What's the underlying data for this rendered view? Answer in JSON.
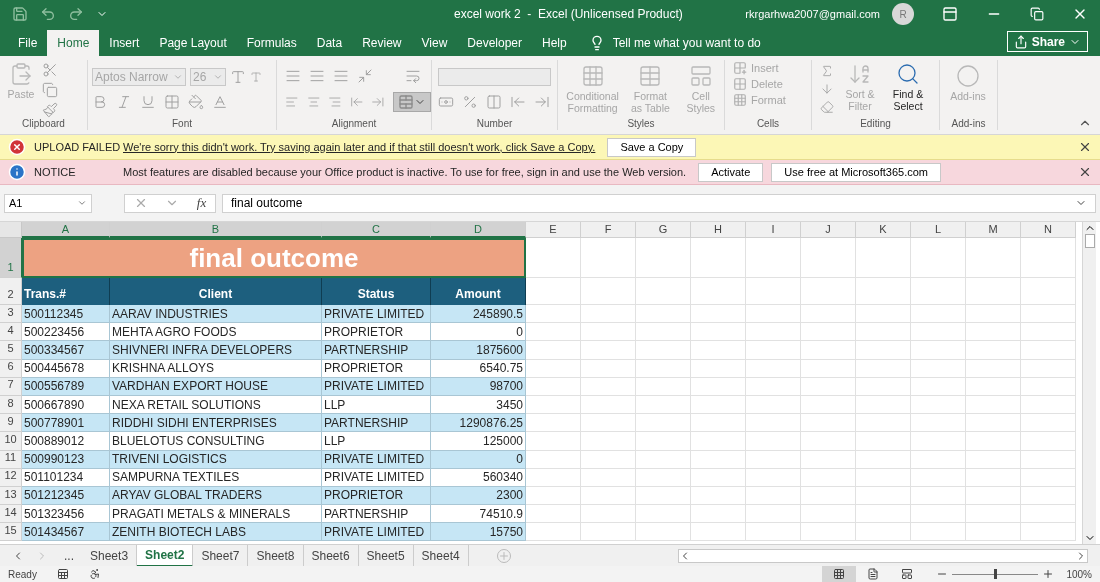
{
  "title_bar": {
    "title": "excel work 2  -  Excel (Unlicensed Product)",
    "account": "rkrgarhwa2007@gmail.com",
    "avatar": "R"
  },
  "menu_tabs": [
    {
      "label": "File",
      "selected": false
    },
    {
      "label": "Home",
      "selected": true
    },
    {
      "label": "Insert",
      "selected": false
    },
    {
      "label": "Page Layout",
      "selected": false
    },
    {
      "label": "Formulas",
      "selected": false
    },
    {
      "label": "Data",
      "selected": false
    },
    {
      "label": "Review",
      "selected": false
    },
    {
      "label": "View",
      "selected": false
    },
    {
      "label": "Developer",
      "selected": false
    },
    {
      "label": "Help",
      "selected": false
    }
  ],
  "tell_me": "Tell me what you want to do",
  "share": "Share",
  "ribbon": {
    "groups": [
      {
        "label": "Clipboard",
        "items": [
          {
            "kind": "large",
            "label": "Paste",
            "disabled": true
          }
        ]
      },
      {
        "label": "Font",
        "items": [
          {
            "kind": "field",
            "value": "Aptos Narrow",
            "disabled": true
          },
          {
            "kind": "field",
            "value": "26",
            "disabled": true
          }
        ]
      },
      {
        "label": "Alignment"
      },
      {
        "label": "Number"
      },
      {
        "label": "Styles",
        "items": [
          {
            "kind": "large",
            "label": "Conditional Formatting",
            "disabled": true
          },
          {
            "kind": "large",
            "label": "Format as Table",
            "disabled": true
          },
          {
            "kind": "large",
            "label": "Cell Styles",
            "disabled": true
          }
        ]
      },
      {
        "label": "Cells",
        "items": [
          {
            "kind": "small",
            "label": "Insert",
            "disabled": true
          },
          {
            "kind": "small",
            "label": "Delete",
            "disabled": true
          },
          {
            "kind": "small",
            "label": "Format",
            "disabled": true
          }
        ]
      },
      {
        "label": "Editing",
        "items": [
          {
            "kind": "large",
            "label": "Sort & Filter",
            "disabled": true
          },
          {
            "kind": "large",
            "label": "Find & Select",
            "disabled": false
          }
        ]
      },
      {
        "label": "Add-ins",
        "items": [
          {
            "kind": "large",
            "label": "Add-ins",
            "disabled": true
          }
        ]
      }
    ]
  },
  "message_bars": [
    {
      "kind": "error",
      "title": "UPLOAD FAILED",
      "message": "We're sorry this didn't work. Try saving again later and if that still doesn't work, click Save a Copy.",
      "buttons": [
        "Save a Copy"
      ]
    },
    {
      "kind": "info",
      "title": "NOTICE",
      "message": "Most features are disabled because your Office product is inactive. To use for free, sign in and use the Web version.",
      "buttons": [
        "Activate",
        "Use free at Microsoft365.com"
      ]
    }
  ],
  "formula_bar": {
    "name_box": "A1",
    "fx": "fx",
    "formula": "final outcome"
  },
  "sheet": {
    "columns": [
      {
        "label": "A",
        "selected": true
      },
      {
        "label": "B",
        "selected": true
      },
      {
        "label": "C",
        "selected": true
      },
      {
        "label": "D",
        "selected": true
      },
      {
        "label": "E",
        "selected": false
      },
      {
        "label": "F",
        "selected": false
      },
      {
        "label": "G",
        "selected": false
      },
      {
        "label": "H",
        "selected": false
      },
      {
        "label": "I",
        "selected": false
      },
      {
        "label": "J",
        "selected": false
      },
      {
        "label": "K",
        "selected": false
      },
      {
        "label": "L",
        "selected": false
      },
      {
        "label": "M",
        "selected": false
      },
      {
        "label": "N",
        "selected": false
      }
    ],
    "title_row": {
      "number": "1",
      "selected": true,
      "text": "final outcome"
    },
    "header_row": {
      "number": "2",
      "selected": false,
      "cells": [
        "Trans.#",
        "Client",
        "Status",
        "Amount"
      ]
    },
    "rows": [
      {
        "number": "3",
        "selected": false,
        "cells": [
          "500112345",
          "AARAV INDUSTRIES",
          "PRIVATE LIMITED",
          "245890.5"
        ]
      },
      {
        "number": "4",
        "selected": false,
        "cells": [
          "500223456",
          "MEHTA AGRO FOODS",
          "PROPRIETOR",
          "0"
        ]
      },
      {
        "number": "5",
        "selected": false,
        "cells": [
          "500334567",
          "SHIVNERI INFRA DEVELOPERS",
          "PARTNERSHIP",
          "1875600"
        ]
      },
      {
        "number": "6",
        "selected": false,
        "cells": [
          "500445678",
          "KRISHNA ALLOYS",
          "PROPRIETOR",
          "6540.75"
        ]
      },
      {
        "number": "7",
        "selected": false,
        "cells": [
          "500556789",
          "VARDHAN EXPORT HOUSE",
          "PRIVATE LIMITED",
          "98700"
        ]
      },
      {
        "number": "8",
        "selected": false,
        "cells": [
          "500667890",
          "NEXA RETAIL SOLUTIONS",
          "LLP",
          "3450"
        ]
      },
      {
        "number": "9",
        "selected": false,
        "cells": [
          "500778901",
          "RIDDHI SIDHI ENTERPRISES",
          "PARTNERSHIP",
          "1290876.25"
        ]
      },
      {
        "number": "10",
        "selected": false,
        "cells": [
          "500889012",
          "BLUELOTUS CONSULTING",
          "LLP",
          "125000"
        ]
      },
      {
        "number": "11",
        "selected": false,
        "cells": [
          "500990123",
          "TRIVENI LOGISTICS",
          "PRIVATE LIMITED",
          "0"
        ]
      },
      {
        "number": "12",
        "selected": false,
        "cells": [
          "501101234",
          "SAMPURNA TEXTILES",
          "PRIVATE LIMITED",
          "560340"
        ]
      },
      {
        "number": "13",
        "selected": false,
        "cells": [
          "501212345",
          "ARYAV GLOBAL TRADERS",
          "PROPRIETOR",
          "2300"
        ]
      },
      {
        "number": "14",
        "selected": false,
        "cells": [
          "501323456",
          "PRAGATI METALS & MINERALS",
          "PARTNERSHIP",
          "74510.9"
        ]
      },
      {
        "number": "15",
        "selected": false,
        "cells": [
          "501434567",
          "ZENITH BIOTECH LABS",
          "PRIVATE LIMITED",
          "15750"
        ]
      }
    ]
  },
  "sheet_tabs": {
    "more": "...",
    "tabs": [
      {
        "label": "Sheet3",
        "selected": false
      },
      {
        "label": "Sheet2",
        "selected": true
      },
      {
        "label": "Sheet7",
        "selected": false
      },
      {
        "label": "Sheet8",
        "selected": false
      },
      {
        "label": "Sheet6",
        "selected": false
      },
      {
        "label": "Sheet5",
        "selected": false
      },
      {
        "label": "Sheet4",
        "selected": false
      }
    ]
  },
  "status_bar": {
    "status": "Ready",
    "views": [
      {
        "selected": true
      },
      {
        "selected": false
      },
      {
        "selected": false
      }
    ],
    "zoom": {
      "level": 0.5,
      "reading": "100%"
    }
  }
}
